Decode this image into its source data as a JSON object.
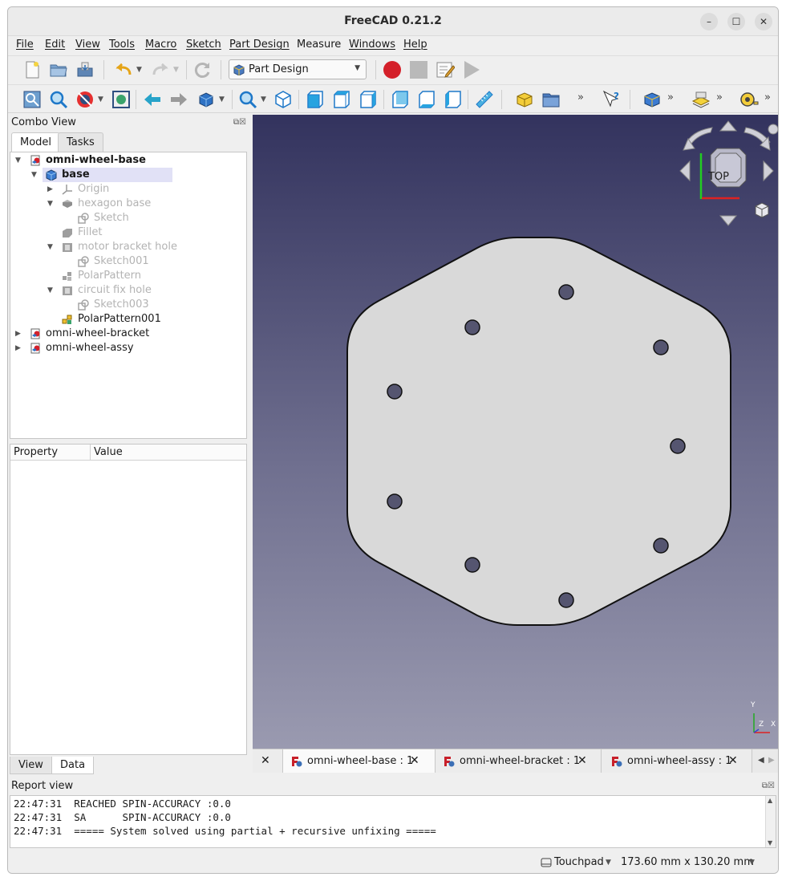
{
  "window": {
    "title": "FreeCAD 0.21.2"
  },
  "menu": [
    "File",
    "Edit",
    "View",
    "Tools",
    "Macro",
    "Sketch",
    "Part Design",
    "Measure",
    "Windows",
    "Help"
  ],
  "workbench": {
    "selected": "Part Design"
  },
  "toolbar": {
    "more": "»"
  },
  "combo_view": {
    "title": "Combo View",
    "tabs": [
      "Model",
      "Tasks"
    ],
    "tree": [
      {
        "label": "omni-wheel-base",
        "icon": "document-icon"
      },
      {
        "label": "base",
        "icon": "body-icon"
      },
      {
        "label": "Origin",
        "icon": "origin-icon"
      },
      {
        "label": "hexagon base",
        "icon": "pad-icon"
      },
      {
        "label": "Sketch",
        "icon": "sketch-icon"
      },
      {
        "label": "Fillet",
        "icon": "fillet-icon"
      },
      {
        "label": "motor bracket hole",
        "icon": "pocket-icon"
      },
      {
        "label": "Sketch001",
        "icon": "sketch-icon"
      },
      {
        "label": "PolarPattern",
        "icon": "polar-pattern-icon"
      },
      {
        "label": "circuit fix hole",
        "icon": "pocket-icon"
      },
      {
        "label": "Sketch003",
        "icon": "sketch-icon"
      },
      {
        "label": "PolarPattern001",
        "icon": "polar-pattern-icon"
      },
      {
        "label": "omni-wheel-bracket",
        "icon": "document-icon"
      },
      {
        "label": "omni-wheel-assy",
        "icon": "document-icon"
      }
    ],
    "property_header": {
      "property": "Property",
      "value": "Value"
    },
    "bottom_tabs": [
      "View",
      "Data"
    ]
  },
  "navcube": {
    "face": "TOP"
  },
  "axes": {
    "x": "X",
    "y": "Y",
    "z": "Z"
  },
  "document_tabs": [
    {
      "label": "omni-wheel-base : 1",
      "active": true
    },
    {
      "label": "omni-wheel-bracket : 1",
      "active": false
    },
    {
      "label": "omni-wheel-assy : 1",
      "active": false
    }
  ],
  "report_view": {
    "title": "Report view",
    "lines": [
      "22:47:31  REACHED SPIN-ACCURACY :0.0",
      "22:47:31  SA      SPIN-ACCURACY :0.0",
      "22:47:31  ===== System solved using partial + recursive unfixing ====="
    ]
  },
  "status": {
    "navigation": "Touchpad",
    "dimensions": "173.60 mm x 130.20 mm"
  },
  "colors": {
    "accent_red": "#d4202a",
    "viewport_top": "#33335e",
    "viewport_bottom": "#9a9ab0",
    "part_face": "#d9d9d9",
    "hole": "#555570"
  }
}
